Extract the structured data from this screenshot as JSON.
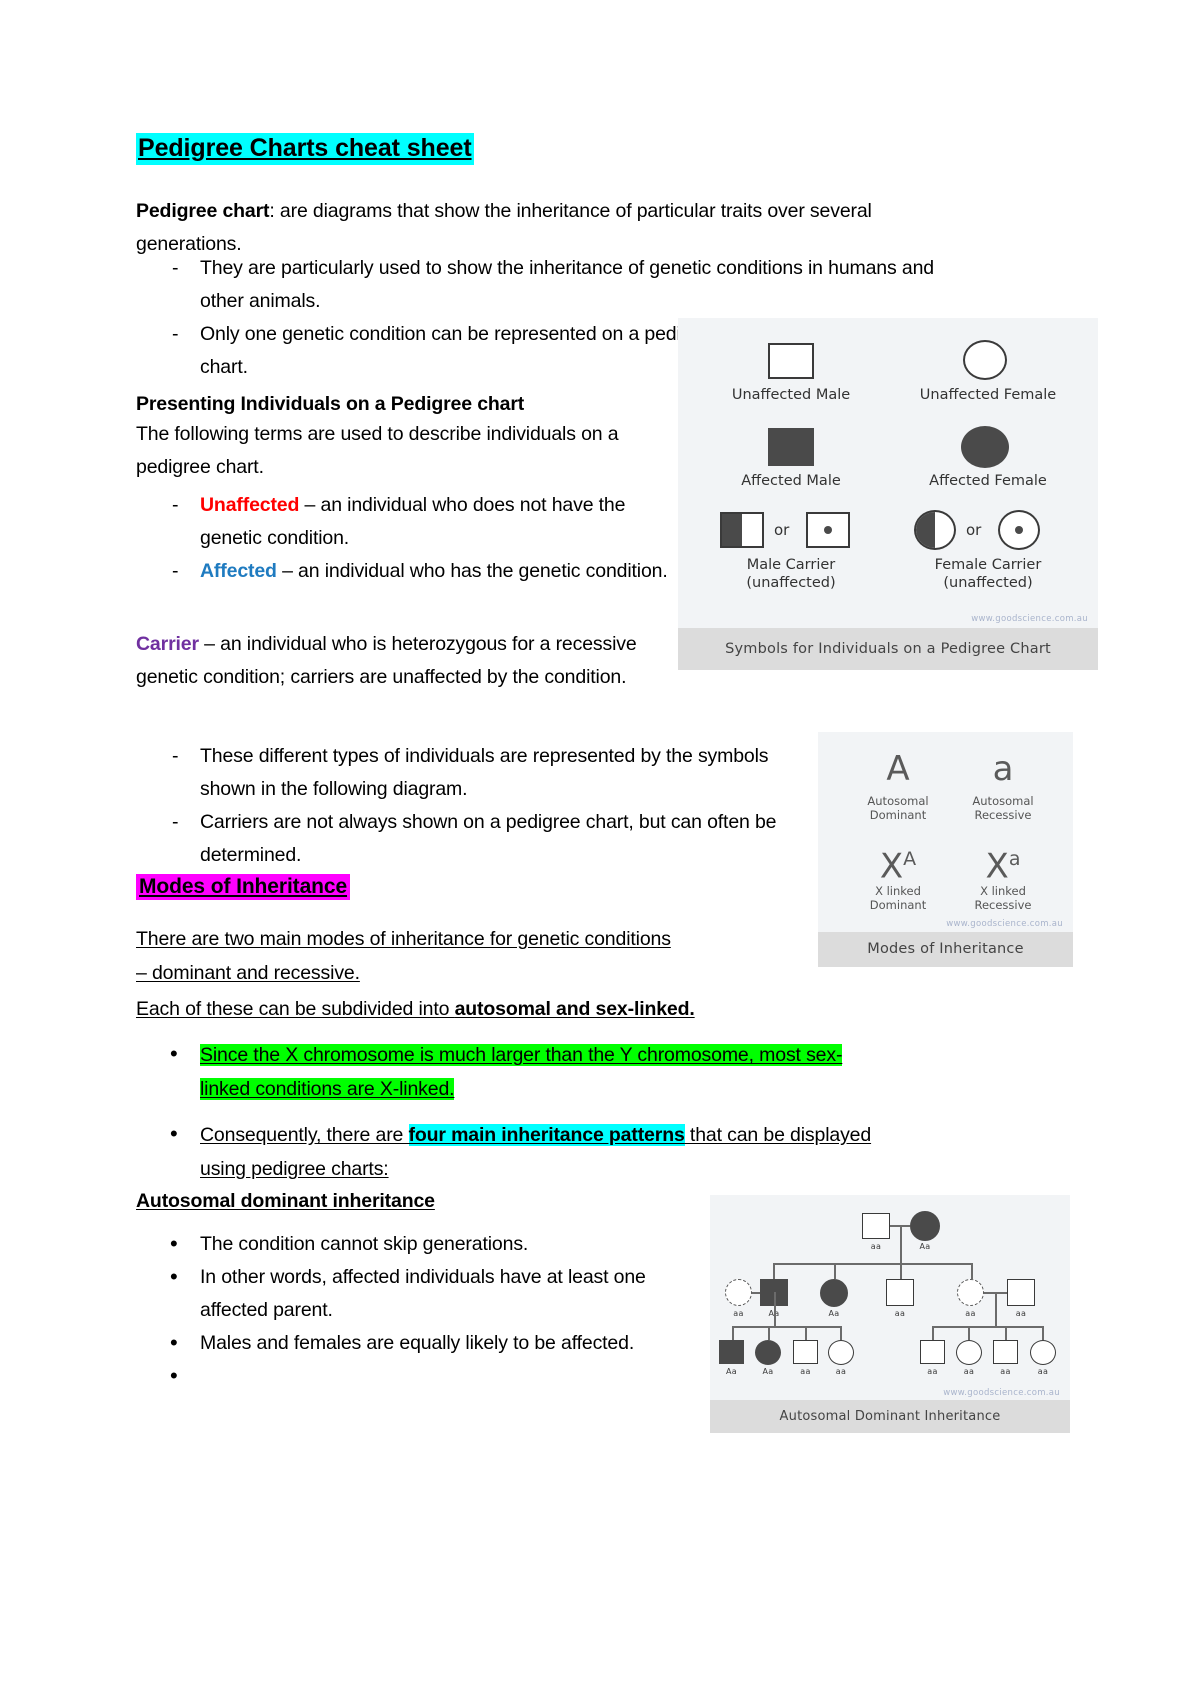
{
  "document": {
    "title": "Pedigree Charts cheat sheet",
    "title_highlight": "#00FFFF"
  },
  "sections": {
    "definition": {
      "term": "Pedigree chart",
      "text": ": are diagrams that show the inheritance of particular traits over several generations.",
      "bullets": [
        "They are particularly used to show the inheritance of genetic conditions in humans and other animals.",
        "Only one genetic condition can be represented on a pedigree chart."
      ]
    },
    "presenting": {
      "heading": "Presenting Individuals on a Pedigree chart",
      "intro": "The following terms are used to describe individuals on a pedigree chart.",
      "terms": [
        {
          "word": "Unaffected",
          "color": "#FF0000",
          "definition": " – an individual who does not have the genetic condition."
        },
        {
          "word": "Affected",
          "color": "#1F7BC0",
          "definition": " – an individual who has the genetic condition."
        }
      ],
      "carrier": {
        "word": "Carrier",
        "color": "#7030A0",
        "definition": " – an individual who is heterozygous for a recessive genetic condition; carriers are unaffected by the condition."
      },
      "bullets": [
        "These different types of individuals are represented by the symbols shown in the following diagram.",
        "Carriers are not always shown on a pedigree chart, but can often be determined."
      ]
    },
    "modes": {
      "heading": "Modes of Inheritance",
      "heading_highlight": "#FF00FF",
      "line1": "There are two main modes of inheritance for genetic conditions",
      "line2": "– dominant and recessive.",
      "line3_pre": "Each of these can be subdivided into ",
      "line3_bold": "autosomal and sex-linked.",
      "bullet_green": "Since the X chromosome is much larger than the Y chromosome, most sex-linked conditions are X-linked.",
      "bullet_green_line1": "Since the X chromosome is much larger than the Y chromosome, most sex-",
      "bullet_green_line2": "linked conditions are X-linked.",
      "bullet_green_highlight": "#00FF00",
      "bullet_cyan_pre": "Consequently, there are ",
      "bullet_cyan_mark": "four main inheritance patterns",
      "bullet_cyan_post": " that can be displayed ",
      "bullet_cyan_line2": "using pedigree charts:",
      "bullet_cyan_highlight": "#00FFFF"
    },
    "autosomal_dominant": {
      "heading": "Autosomal dominant inheritance",
      "bullets": [
        "The condition cannot skip generations.",
        "In other words, affected individuals have at least one affected parent.",
        "Males and females are equally likely to be affected.",
        ""
      ]
    }
  },
  "figures": {
    "symbols": {
      "caption": "Symbols for Individuals on a Pedigree Chart",
      "watermark": "www.goodscience.com.au",
      "items": [
        {
          "label": "Unaffected Male",
          "shape": "square-open"
        },
        {
          "label": "Unaffected Female",
          "shape": "circle-open"
        },
        {
          "label": "Affected Male",
          "shape": "square-filled"
        },
        {
          "label": "Affected Female",
          "shape": "circle-filled"
        },
        {
          "label_line1": "Male Carrier",
          "label_line2": "(unaffected)",
          "shape": "square-half",
          "or": "or",
          "alt_shape": "square-dot"
        },
        {
          "label_line1": "Female Carrier",
          "label_line2": "(unaffected)",
          "shape": "circle-half",
          "or": "or",
          "alt_shape": "circle-dot"
        }
      ]
    },
    "modes_of_inheritance": {
      "caption": "Modes of Inheritance",
      "watermark": "www.goodscience.com.au",
      "items": [
        {
          "glyph": "A",
          "sup": "",
          "line1": "Autosomal",
          "line2": "Dominant"
        },
        {
          "glyph": "a",
          "sup": "",
          "line1": "Autosomal",
          "line2": "Recessive"
        },
        {
          "glyph": "X",
          "sup": "A",
          "line1": "X linked",
          "line2": "Dominant"
        },
        {
          "glyph": "X",
          "sup": "a",
          "line1": "X linked",
          "line2": "Recessive"
        }
      ]
    },
    "pedigree": {
      "caption": "Autosomal Dominant Inheritance",
      "watermark": "www.goodscience.com.au",
      "generation1": [
        {
          "sex": "male",
          "status": "unaffected",
          "genotype": "aa"
        },
        {
          "sex": "female",
          "status": "affected",
          "genotype": "Aa"
        }
      ],
      "generation2": [
        {
          "sex": "female",
          "status": "carrier-dashed",
          "genotype": "aa"
        },
        {
          "sex": "male",
          "status": "affected",
          "genotype": "Aa"
        },
        {
          "sex": "female",
          "status": "affected",
          "genotype": "Aa"
        },
        {
          "sex": "male",
          "status": "unaffected",
          "genotype": "aa"
        },
        {
          "sex": "female",
          "status": "carrier-dashed",
          "genotype": "aa"
        },
        {
          "sex": "male",
          "status": "unaffected",
          "genotype": "aa"
        }
      ],
      "generation3": [
        {
          "sex": "male",
          "status": "affected",
          "genotype": "Aa"
        },
        {
          "sex": "female",
          "status": "affected",
          "genotype": "Aa"
        },
        {
          "sex": "male",
          "status": "unaffected",
          "genotype": "aa"
        },
        {
          "sex": "female",
          "status": "unaffected",
          "genotype": "aa"
        },
        {
          "sex": "male",
          "status": "unaffected",
          "genotype": "aa"
        },
        {
          "sex": "female",
          "status": "unaffected",
          "genotype": "aa"
        },
        {
          "sex": "male",
          "status": "unaffected",
          "genotype": "aa"
        },
        {
          "sex": "female",
          "status": "unaffected",
          "genotype": "aa"
        }
      ]
    }
  }
}
